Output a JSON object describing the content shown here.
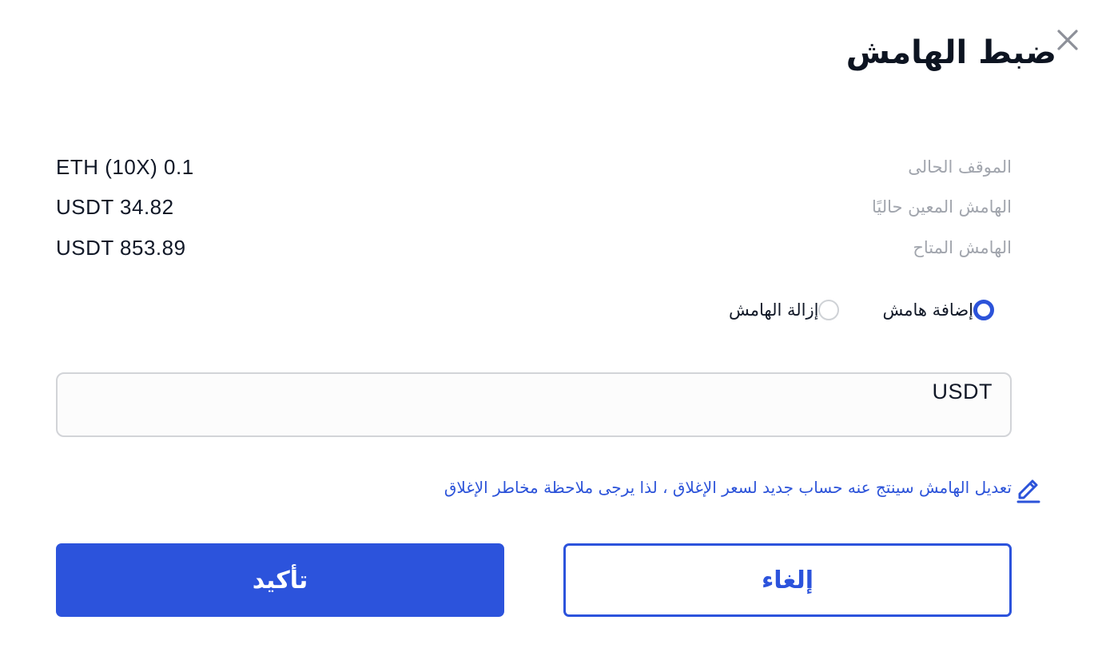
{
  "dialog": {
    "title": "ضبط الهامش",
    "close_icon": "close-icon"
  },
  "info": {
    "current_position_label": "الموقف الحالى",
    "current_position_value": "ETH (10X) 0.1",
    "assigned_margin_label": "الهامش المعين حاليًا",
    "assigned_margin_value": "USDT 34.82",
    "available_margin_label": "الهامش المتاح",
    "available_margin_value": "USDT 853.89"
  },
  "mode": {
    "add_label": "إضافة هامش",
    "remove_label": "إزالة الهامش",
    "selected": "add"
  },
  "amount": {
    "value": "",
    "unit": "USDT"
  },
  "notice": {
    "icon": "edit-icon",
    "text": "تعديل الهامش سينتج عنه حساب جديد لسعر الإغلاق ، لذا يرجى ملاحظة مخاطر الإغلاق"
  },
  "buttons": {
    "confirm_label": "تأكيد",
    "cancel_label": "إلغاء"
  },
  "colors": {
    "accent": "#2c53dc",
    "muted_label": "#a1a5ad",
    "text": "#111827"
  }
}
